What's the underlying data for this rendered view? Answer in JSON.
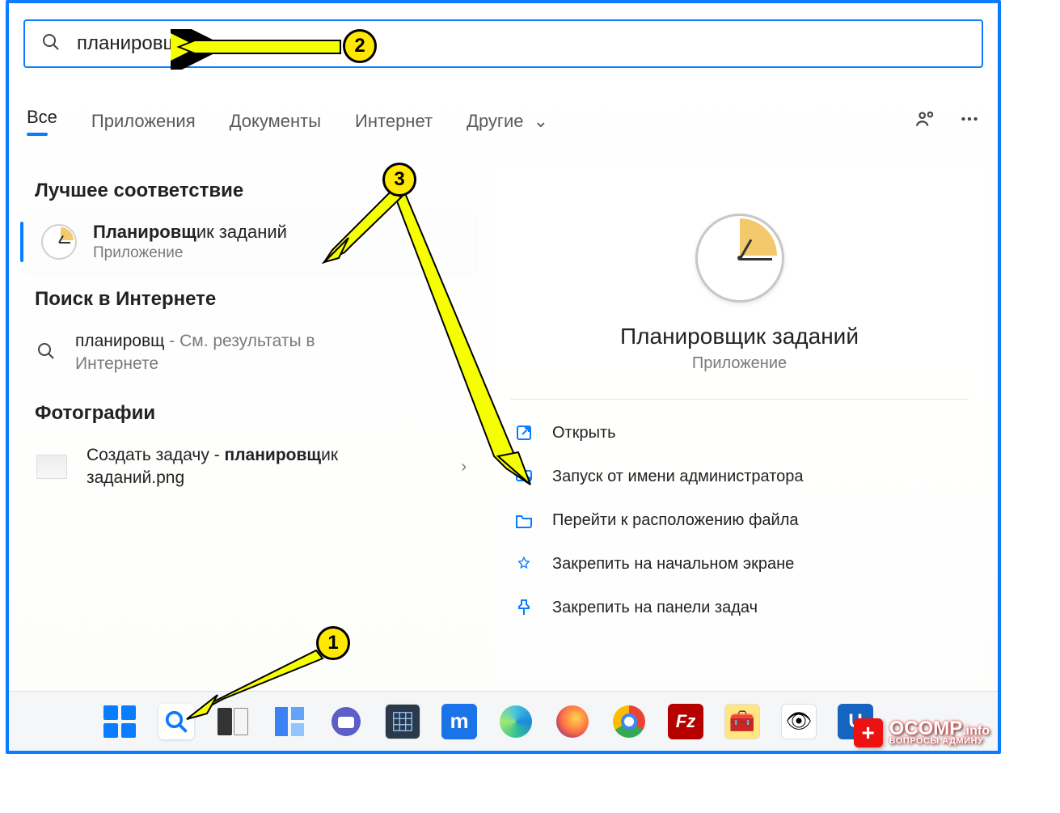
{
  "search": {
    "query": "планировщ"
  },
  "tabs": {
    "all": "Все",
    "apps": "Приложения",
    "docs": "Документы",
    "web": "Интернет",
    "other": "Другие"
  },
  "sections": {
    "best": "Лучшее соответствие",
    "web": "Поиск в Интернете",
    "photos": "Фотографии"
  },
  "best_match": {
    "title_bold": "Планировщ",
    "title_rest": "ик заданий",
    "subtitle": "Приложение"
  },
  "web_result": {
    "query": "планировщ",
    "suffix": " - См. результаты в Интернете"
  },
  "photo_result": {
    "prefix": "Создать задачу - ",
    "bold": "планировщ",
    "suffix": "ик заданий.png"
  },
  "preview": {
    "title": "Планировщик заданий",
    "subtitle": "Приложение",
    "actions": {
      "open": "Открыть",
      "admin": "Запуск от имени администратора",
      "location": "Перейти к расположению файла",
      "pin_start": "Закрепить на начальном экране",
      "pin_taskbar": "Закрепить на панели задач"
    }
  },
  "annotations": {
    "b1": "1",
    "b2": "2",
    "b3": "3"
  },
  "watermark": {
    "brand": "OCOMP",
    "tld": ".info",
    "tagline": "ВОПРОСЫ АДМИНУ"
  }
}
